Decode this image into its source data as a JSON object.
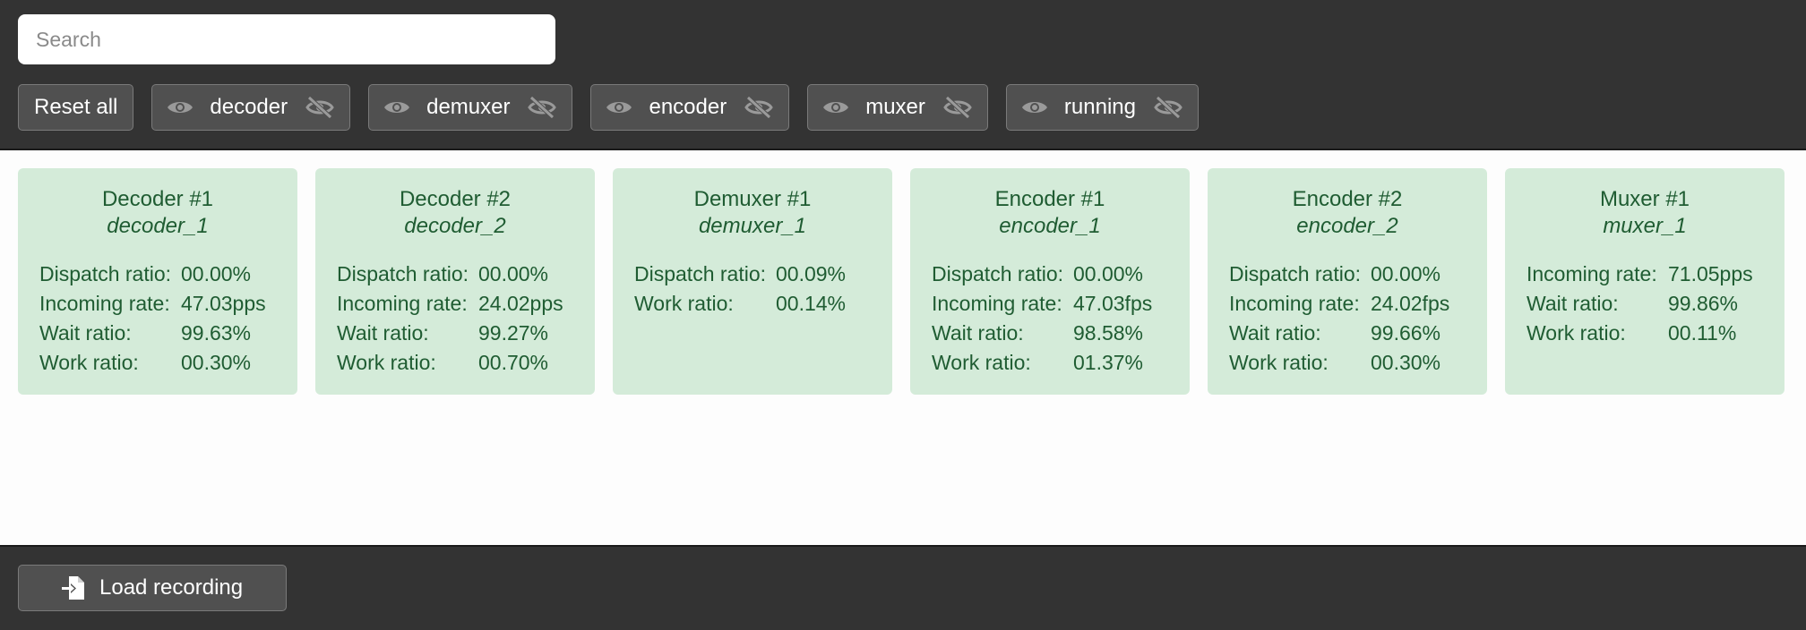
{
  "search": {
    "placeholder": "Search",
    "value": ""
  },
  "toolbar": {
    "reset_label": "Reset all",
    "filters": [
      {
        "label": "decoder",
        "show_icon": "eye-icon",
        "hide_icon": "eye-off-icon"
      },
      {
        "label": "demuxer",
        "show_icon": "eye-icon",
        "hide_icon": "eye-off-icon"
      },
      {
        "label": "encoder",
        "show_icon": "eye-icon",
        "hide_icon": "eye-off-icon"
      },
      {
        "label": "muxer",
        "show_icon": "eye-icon",
        "hide_icon": "eye-off-icon"
      },
      {
        "label": "running",
        "show_icon": "eye-icon",
        "hide_icon": "eye-off-icon"
      }
    ]
  },
  "cards": [
    {
      "title": "Decoder #1",
      "id": "decoder_1",
      "rows": [
        {
          "label": "Dispatch ratio:",
          "value": "00.00%"
        },
        {
          "label": "Incoming rate:",
          "value": "47.03pps"
        },
        {
          "label": "Wait ratio:",
          "value": "99.63%"
        },
        {
          "label": "Work ratio:",
          "value": "00.30%"
        }
      ]
    },
    {
      "title": "Decoder #2",
      "id": "decoder_2",
      "rows": [
        {
          "label": "Dispatch ratio:",
          "value": "00.00%"
        },
        {
          "label": "Incoming rate:",
          "value": "24.02pps"
        },
        {
          "label": "Wait ratio:",
          "value": "99.27%"
        },
        {
          "label": "Work ratio:",
          "value": "00.70%"
        }
      ]
    },
    {
      "title": "Demuxer #1",
      "id": "demuxer_1",
      "rows": [
        {
          "label": "Dispatch ratio:",
          "value": "00.09%"
        },
        {
          "label": "Work ratio:",
          "value": "00.14%"
        }
      ]
    },
    {
      "title": "Encoder #1",
      "id": "encoder_1",
      "rows": [
        {
          "label": "Dispatch ratio:",
          "value": "00.00%"
        },
        {
          "label": "Incoming rate:",
          "value": "47.03fps"
        },
        {
          "label": "Wait ratio:",
          "value": "98.58%"
        },
        {
          "label": "Work ratio:",
          "value": "01.37%"
        }
      ]
    },
    {
      "title": "Encoder #2",
      "id": "encoder_2",
      "rows": [
        {
          "label": "Dispatch ratio:",
          "value": "00.00%"
        },
        {
          "label": "Incoming rate:",
          "value": "24.02fps"
        },
        {
          "label": "Wait ratio:",
          "value": "99.66%"
        },
        {
          "label": "Work ratio:",
          "value": "00.30%"
        }
      ]
    },
    {
      "title": "Muxer #1",
      "id": "muxer_1",
      "rows": [
        {
          "label": "Incoming rate:",
          "value": "71.05pps"
        },
        {
          "label": "Wait ratio:",
          "value": "99.86%"
        },
        {
          "label": "Work ratio:",
          "value": "00.11%"
        }
      ]
    }
  ],
  "footer": {
    "load_label": "Load recording",
    "load_icon": "file-import-icon"
  },
  "colors": {
    "bar_bg": "#333333",
    "button_bg": "#505050",
    "card_bg": "#d4ebd9",
    "card_text": "#1f5c32"
  }
}
